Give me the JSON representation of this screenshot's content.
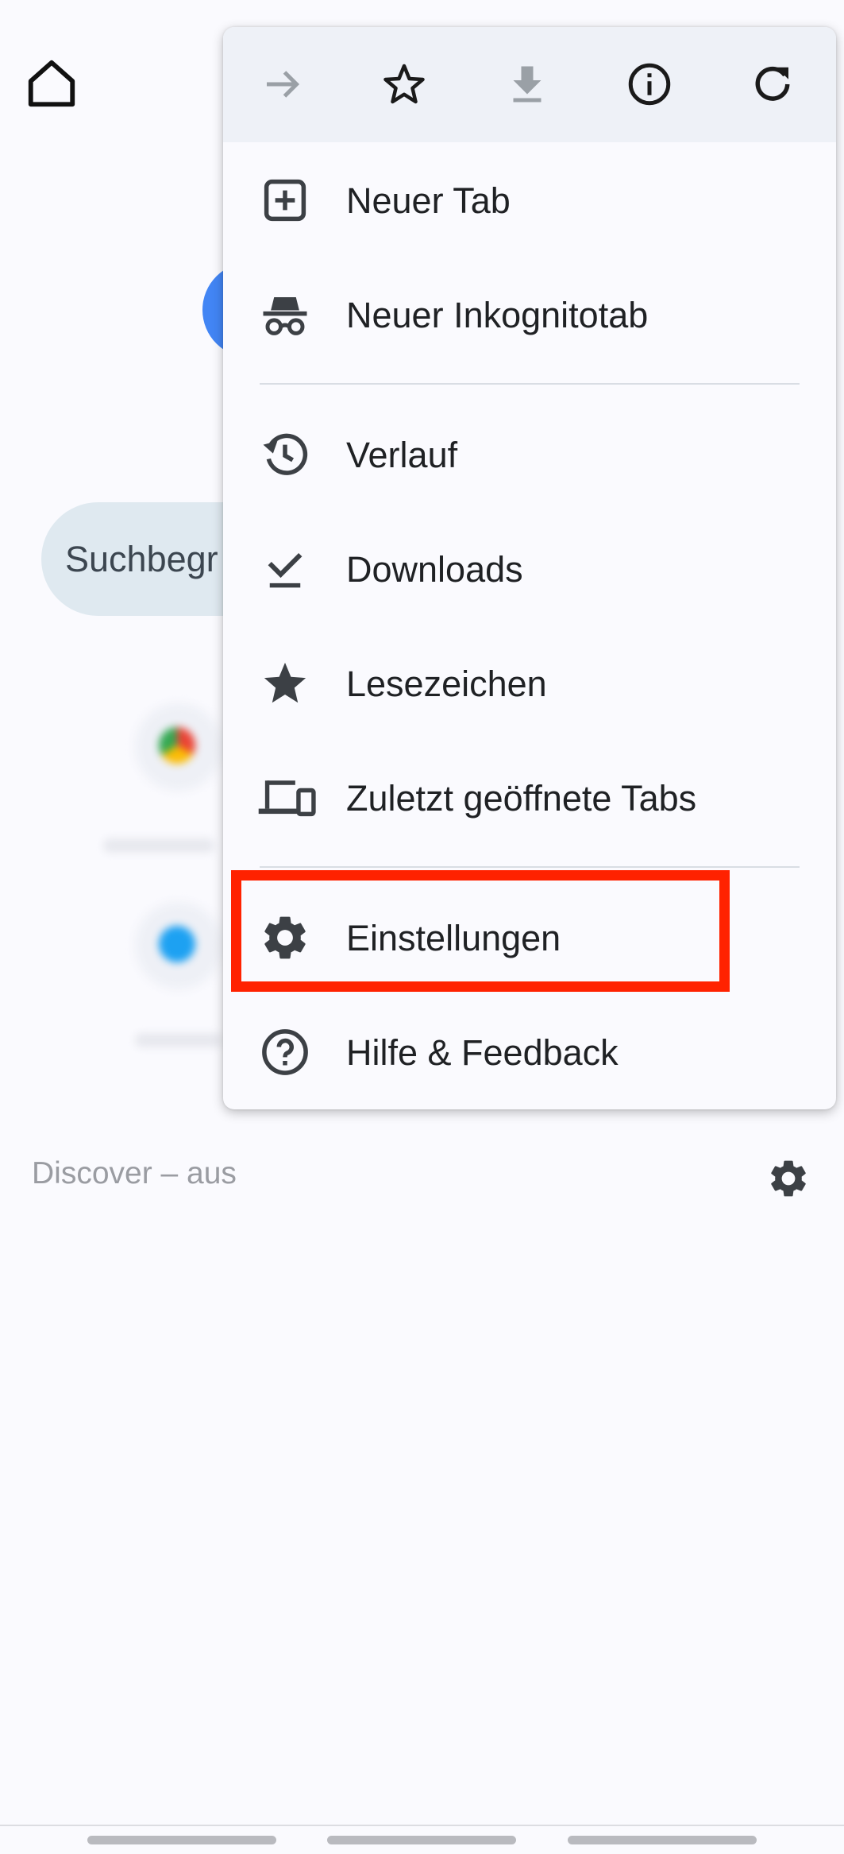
{
  "background": {
    "search_placeholder": "Suchbegr",
    "discover_text": "Discover – aus"
  },
  "menu": {
    "toolbar": [
      {
        "name": "forward-icon",
        "enabled": false
      },
      {
        "name": "star-outline-icon",
        "enabled": true
      },
      {
        "name": "download-icon",
        "enabled": false
      },
      {
        "name": "info-icon",
        "enabled": true
      },
      {
        "name": "refresh-icon",
        "enabled": true
      }
    ],
    "items": [
      {
        "label": "Neuer Tab",
        "icon": "new-tab-icon"
      },
      {
        "label": "Neuer Inkognitotab",
        "icon": "incognito-icon"
      },
      {
        "label": "Verlauf",
        "icon": "history-icon"
      },
      {
        "label": "Downloads",
        "icon": "downloads-check-icon"
      },
      {
        "label": "Lesezeichen",
        "icon": "star-filled-icon"
      },
      {
        "label": "Zuletzt geöffnete Tabs",
        "icon": "devices-icon"
      },
      {
        "label": "Einstellungen",
        "icon": "gear-icon"
      },
      {
        "label": "Hilfe & Feedback",
        "icon": "help-icon"
      }
    ],
    "highlighted_item": "Einstellungen",
    "highlight_color": "#ff2200"
  }
}
